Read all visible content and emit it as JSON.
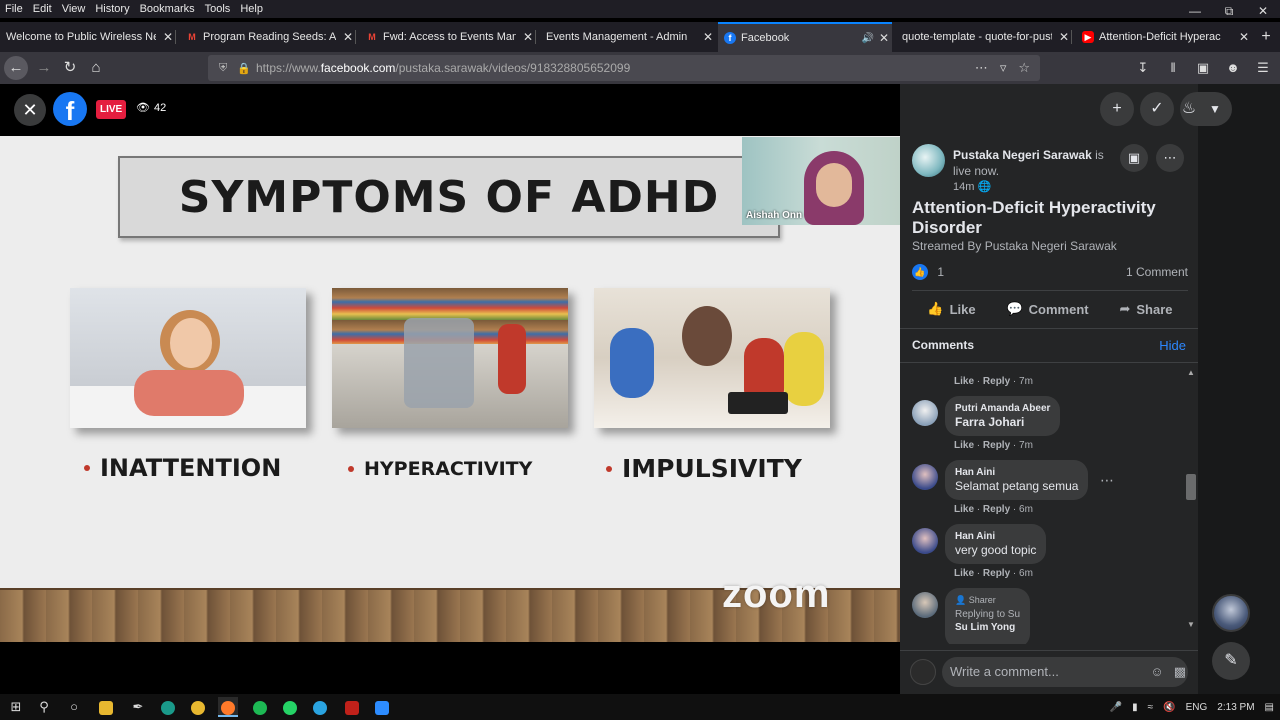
{
  "menubar": {
    "items": [
      "File",
      "Edit",
      "View",
      "History",
      "Bookmarks",
      "Tools",
      "Help"
    ]
  },
  "tabs": [
    {
      "title": "Welcome to Public Wireless Netw",
      "favicon": "wifi-globe-icon",
      "active": false
    },
    {
      "title": "Program Reading Seeds: Attr",
      "favicon": "gmail-icon",
      "active": false
    },
    {
      "title": "Fwd: Access to Events Manag",
      "favicon": "gmail-icon",
      "active": false
    },
    {
      "title": "Events Management - Admin",
      "favicon": "none",
      "active": false
    },
    {
      "title": "Facebook",
      "favicon": "facebook-icon",
      "active": true,
      "audio": true
    },
    {
      "title": "quote-template - quote-for-pust",
      "favicon": "none",
      "active": false
    },
    {
      "title": "Attention-Deficit Hyperac",
      "favicon": "youtube-icon",
      "active": false,
      "audio": true
    }
  ],
  "navbar": {
    "url_prefix": "https://www.",
    "url_host": "facebook.com",
    "url_path": "/pustaka.sarawak/videos/918328805652099"
  },
  "video": {
    "live_label": "LIVE",
    "viewer_count": "42",
    "slide_title": "SYMPTOMS OF ADHD",
    "symptoms": [
      "INATTENTION",
      "HYPERACTIVITY",
      "IMPULSIVITY"
    ],
    "watermark": "zoom",
    "camera_name": "Aishah Onn"
  },
  "post": {
    "page_name": "Pustaka Negeri Sarawak",
    "status_text": "is live now.",
    "time": "14m",
    "title": "Attention-Deficit Hyperactivity Disorder",
    "streamed_by": "Streamed By Pustaka Negeri Sarawak",
    "reaction_count": "1",
    "comment_count": "1 Comment",
    "actions": {
      "like": "Like",
      "comment": "Comment",
      "share": "Share"
    }
  },
  "comments_section": {
    "header": "Comments",
    "hide_label": "Hide",
    "meta_like": "Like",
    "meta_reply": "Reply",
    "items": [
      {
        "author": "Putri Amanda Abeer",
        "text": "Farra Johari",
        "time": "7m",
        "text_bold": true
      },
      {
        "author": "Han Aini",
        "text": "Selamat petang semua",
        "time": "6m"
      },
      {
        "author": "Han Aini",
        "text": "very good topic",
        "time": "6m"
      },
      {
        "badge": "Sharer",
        "reply_to": "Replying to Su",
        "reply_name": "Su Lim Yong"
      }
    ],
    "prev_meta_time": "7m"
  },
  "composer": {
    "placeholder": "Write a comment..."
  },
  "taskbar": {
    "language": "ENG",
    "time": "2:13 PM"
  }
}
